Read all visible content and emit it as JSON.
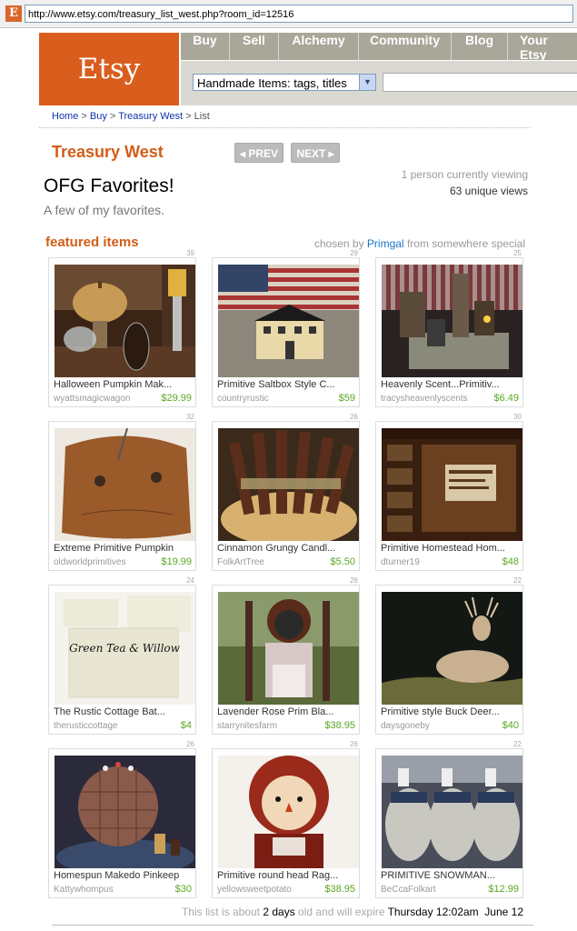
{
  "browser": {
    "url": "http://www.etsy.com/treasury_list_west.php?room_id=12516",
    "favicon": "E"
  },
  "header": {
    "logo": "Etsy",
    "nav": [
      "Buy",
      "Sell",
      "Alchemy",
      "Community",
      "Blog",
      "Your Etsy"
    ],
    "search_select": "Handmade Items: tags, titles",
    "search_value": ""
  },
  "breadcrumb": {
    "home": "Home",
    "sep": " > ",
    "buy": "Buy",
    "treasury": "Treasury West",
    "current": "List"
  },
  "treasury": {
    "name": "Treasury West",
    "prev": "PREV",
    "next": "NEXT",
    "title": "OFG Favorites!",
    "subtitle": "A few of my favorites.",
    "viewing": "1 person currently viewing",
    "views": "63 unique views"
  },
  "featured": {
    "heading": "featured items",
    "chosen_by": "chosen by",
    "curator": "Primgal",
    "from": "from",
    "location": "somewhere special"
  },
  "items": [
    {
      "num": "39",
      "title": "Halloween Pumpkin Mak...",
      "seller": "wyattsmagicwagon",
      "price": "$29.99"
    },
    {
      "num": "29",
      "title": "Primitive Saltbox Style C...",
      "seller": "countryrustic",
      "price": "$59"
    },
    {
      "num": "25",
      "title": "Heavenly Scent...Primitiv...",
      "seller": "tracysheavenlyscents",
      "price": "$6.49"
    },
    {
      "num": "32",
      "title": "Extreme Primitive Pumpkin",
      "seller": "oldworldprimitives",
      "price": "$19.99"
    },
    {
      "num": "26",
      "title": "Cinnamon Grungy Candl...",
      "seller": "FolkArtTree",
      "price": "$5.50"
    },
    {
      "num": "30",
      "title": "Primitive Homestead Hom...",
      "seller": "dturner19",
      "price": "$48"
    },
    {
      "num": "24",
      "title": "The Rustic Cottage Bat...",
      "seller": "therusticcottage",
      "price": "$4"
    },
    {
      "num": "26",
      "title": "Lavender Rose Prim Bla...",
      "seller": "starrynitesfarm",
      "price": "$38.95"
    },
    {
      "num": "22",
      "title": "Primitive style Buck Deer...",
      "seller": "daysgoneby",
      "price": "$40"
    },
    {
      "num": "26",
      "title": "Homespun Makedo Pinkeep",
      "seller": "Kattywhompus",
      "price": "$30"
    },
    {
      "num": "26",
      "title": "Primitive round head Rag...",
      "seller": "yellowsweetpotato",
      "price": "$38.95"
    },
    {
      "num": "22",
      "title": "PRIMITIVE SNOWMAN...",
      "seller": "BeCcaFolkart",
      "price": "$12.99"
    }
  ],
  "soap_label": "Green Tea & Willow",
  "expire": {
    "prefix": "This list is about",
    "age": "2 days",
    "middle": "old and will expire",
    "date": "Thursday 12:02am",
    "day": "June 12"
  }
}
